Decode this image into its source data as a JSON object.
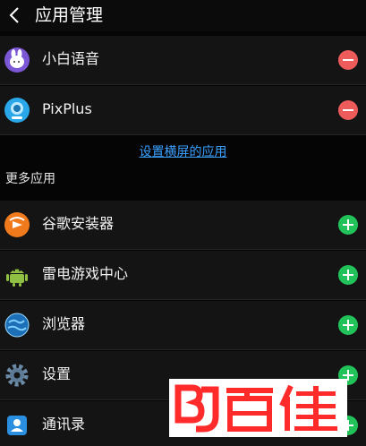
{
  "header": {
    "title": "应用管理"
  },
  "landscape_apps": [
    {
      "label": "小白语音",
      "icon": "xiaobai-voice-icon",
      "action": "remove"
    },
    {
      "label": "PixPlus",
      "icon": "pixplus-icon",
      "action": "remove"
    }
  ],
  "landscape_link": "设置横屏的应用",
  "more_apps": {
    "title": "更多应用",
    "items": [
      {
        "label": "谷歌安装器",
        "icon": "google-installer-icon",
        "action": "add"
      },
      {
        "label": "雷电游戏中心",
        "icon": "android-robot-icon",
        "action": "add"
      },
      {
        "label": "浏览器",
        "icon": "browser-globe-icon",
        "action": "add"
      },
      {
        "label": "设置",
        "icon": "settings-gear-icon",
        "action": "add"
      },
      {
        "label": "通讯录",
        "icon": "contacts-icon",
        "action": "add"
      }
    ]
  },
  "watermark": {
    "text": "百佳",
    "logo": "BJ"
  },
  "colors": {
    "remove": "#ee5b5b",
    "add": "#22c25a",
    "link": "#3aa0ff",
    "watermark": "#ff2a2a"
  }
}
